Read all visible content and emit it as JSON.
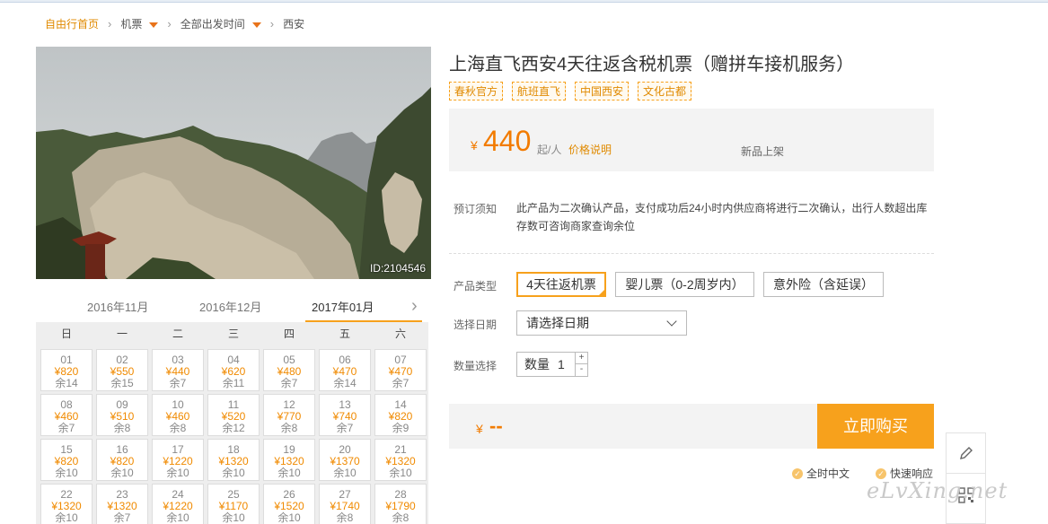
{
  "breadcrumb": {
    "home": "自由行首页",
    "flight": "机票",
    "time": "全部出发时间",
    "city": "西安",
    "sep": "›"
  },
  "hero": {
    "photo_id": "ID:2104546"
  },
  "calendar": {
    "months": [
      "2016年11月",
      "2016年12月",
      "2017年01月"
    ],
    "active_month": "2017年01月",
    "next_icon": "›",
    "weekdays": [
      "日",
      "一",
      "二",
      "三",
      "四",
      "五",
      "六"
    ],
    "rows": [
      [
        {
          "d": "01",
          "p": "¥820",
          "r": "余14"
        },
        {
          "d": "02",
          "p": "¥550",
          "r": "余15"
        },
        {
          "d": "03",
          "p": "¥440",
          "r": "余7"
        },
        {
          "d": "04",
          "p": "¥620",
          "r": "余11"
        },
        {
          "d": "05",
          "p": "¥480",
          "r": "余7"
        },
        {
          "d": "06",
          "p": "¥470",
          "r": "余14"
        },
        {
          "d": "07",
          "p": "¥470",
          "r": "余7"
        }
      ],
      [
        {
          "d": "08",
          "p": "¥460",
          "r": "余7"
        },
        {
          "d": "09",
          "p": "¥510",
          "r": "余8"
        },
        {
          "d": "10",
          "p": "¥460",
          "r": "余8"
        },
        {
          "d": "11",
          "p": "¥520",
          "r": "余12"
        },
        {
          "d": "12",
          "p": "¥770",
          "r": "余8"
        },
        {
          "d": "13",
          "p": "¥740",
          "r": "余7"
        },
        {
          "d": "14",
          "p": "¥820",
          "r": "余9"
        }
      ],
      [
        {
          "d": "15",
          "p": "¥820",
          "r": "余10"
        },
        {
          "d": "16",
          "p": "¥820",
          "r": "余10"
        },
        {
          "d": "17",
          "p": "¥1220",
          "r": "余10"
        },
        {
          "d": "18",
          "p": "¥1320",
          "r": "余10"
        },
        {
          "d": "19",
          "p": "¥1320",
          "r": "余10"
        },
        {
          "d": "20",
          "p": "¥1370",
          "r": "余10"
        },
        {
          "d": "21",
          "p": "¥1320",
          "r": "余10"
        }
      ],
      [
        {
          "d": "22",
          "p": "¥1320",
          "r": "余10"
        },
        {
          "d": "23",
          "p": "¥1320",
          "r": "余7"
        },
        {
          "d": "24",
          "p": "¥1220",
          "r": "余10"
        },
        {
          "d": "25",
          "p": "¥1170",
          "r": "余10"
        },
        {
          "d": "26",
          "p": "¥1520",
          "r": "余10"
        },
        {
          "d": "27",
          "p": "¥1740",
          "r": "余8"
        },
        {
          "d": "28",
          "p": "¥1790",
          "r": "余8"
        }
      ]
    ]
  },
  "product": {
    "title": "上海直飞西安4天往返含税机票（赠拼车接机服务）",
    "tags": [
      "春秋官方",
      "航班直飞",
      "中国西安",
      "文化古都"
    ],
    "currency": "¥",
    "price": "440",
    "per_person": "起/人",
    "price_note": "价格说明",
    "new_listing": "新品上架"
  },
  "booking": {
    "notice_label": "预订须知",
    "notice_text": "此产品为二次确认产品，支付成功后24小时内供应商将进行二次确认，出行人数超出库存数可咨询商家查询余位",
    "type_label": "产品类型",
    "types": [
      "4天往返机票",
      "婴儿票（0-2周岁内）",
      "意外险（含延误）"
    ],
    "date_label": "选择日期",
    "date_placeholder": "请选择日期",
    "qty_label": "数量选择",
    "qty_field_label": "数量",
    "qty_value": "1",
    "plus": "+",
    "minus": "-",
    "total_currency": "¥",
    "total": "--",
    "buy_label": "立即购买",
    "guarantees": [
      "全时中文",
      "快速响应"
    ],
    "check_icon": "✓"
  },
  "watermark": "eLvXing.net",
  "colors": {
    "accent": "#f7a11c",
    "price": "#f27b00"
  }
}
